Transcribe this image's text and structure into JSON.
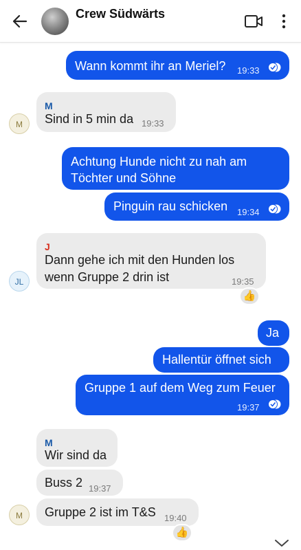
{
  "header": {
    "title": "Crew Südwärts",
    "back_icon": "arrow-left-icon",
    "video_icon": "video-call-icon",
    "menu_icon": "more-vertical-icon"
  },
  "colors": {
    "outgoing": "#1255ea",
    "incoming": "#ebebeb",
    "sender_m": "#1a5aa8",
    "sender_j": "#d62f1f"
  },
  "messages": [
    {
      "dir": "out",
      "text": "Wann kommt ihr an Meriel?",
      "time": "19:33",
      "read": true
    },
    {
      "dir": "in",
      "sender": "M",
      "text": "Sind in 5 min da",
      "time": "19:33"
    },
    {
      "dir": "out",
      "line1": "Achtung Hunde nicht zu nah am",
      "line2": "Töchter und Söhne"
    },
    {
      "dir": "out",
      "text": "Pinguin rau schicken",
      "time": "19:34",
      "read": true
    },
    {
      "dir": "in",
      "sender": "J",
      "line1": "Dann gehe ich mit den Hunden los",
      "line2": "wenn Gruppe 2 drin ist",
      "time": "19:35",
      "reaction": "👍"
    },
    {
      "dir": "out",
      "text": "Ja"
    },
    {
      "dir": "out",
      "text": "Hallentür öffnet sich"
    },
    {
      "dir": "out",
      "text": "Gruppe 1 auf dem Weg zum Feuer",
      "time": "19:37",
      "read": true
    },
    {
      "dir": "in",
      "sender": "M",
      "text": "Wir sind da"
    },
    {
      "dir": "in",
      "text": "Buss 2",
      "time": "19:37"
    },
    {
      "dir": "in",
      "text": "Gruppe 2 ist im T&S",
      "time": "19:40",
      "reaction": "👍"
    }
  ],
  "avatars": {
    "m": "M",
    "jl": "JL"
  }
}
